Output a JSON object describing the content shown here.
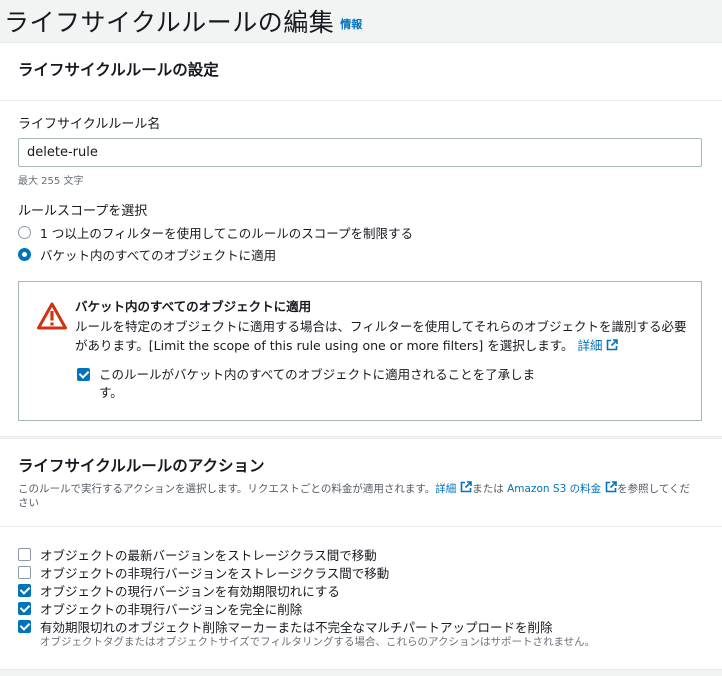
{
  "header": {
    "title": "ライフサイクルルールの編集",
    "info_link": "情報"
  },
  "config": {
    "section_title": "ライフサイクルルールの設定",
    "rule_name_label": "ライフサイクルルール名",
    "rule_name_value": "delete-rule",
    "rule_name_hint": "最大 255 文字",
    "scope_label": "ルールスコープを選択",
    "scope_options": [
      {
        "label": "1 つ以上のフィルターを使用してこのルールのスコープを制限する",
        "selected": false
      },
      {
        "label": "バケット内のすべてのオブジェクトに適用",
        "selected": true
      }
    ],
    "alert": {
      "title": "バケット内のすべてのオブジェクトに適用",
      "body": "ルールを特定のオブジェクトに適用する場合は、フィルターを使用してそれらのオブジェクトを識別する必要があります。[Limit the scope of this rule using one or more filters] を選択します。",
      "link": "詳細",
      "ack_label": "このルールがバケット内のすべてのオブジェクトに適用されることを了承します。",
      "ack_checked": true
    }
  },
  "actions": {
    "section_title": "ライフサイクルルールのアクション",
    "desc_prefix": "このルールで実行するアクションを選択します。リクエストごとの料金が適用されます。",
    "desc_link1": "詳細",
    "desc_middle": "または",
    "desc_link2": "Amazon S3 の料金",
    "desc_suffix": "を参照してください",
    "items": [
      {
        "label": "オブジェクトの最新バージョンをストレージクラス間で移動",
        "checked": false
      },
      {
        "label": "オブジェクトの非現行バージョンをストレージクラス間で移動",
        "checked": false
      },
      {
        "label": "オブジェクトの現行バージョンを有効期限切れにする",
        "checked": true
      },
      {
        "label": "オブジェクトの非現行バージョンを完全に削除",
        "checked": true
      },
      {
        "label": "有効期限切れのオブジェクト削除マーカーまたは不完全なマルチパートアップロードを削除",
        "checked": true
      }
    ],
    "note": "オブジェクトタグまたはオブジェクトサイズでフィルタリングする場合、これらのアクションはサポートされません。"
  },
  "colors": {
    "accent": "#0073bb",
    "warning": "#d13212"
  },
  "icons": {
    "warning": "warning-icon",
    "external_link": "external-link-icon"
  }
}
